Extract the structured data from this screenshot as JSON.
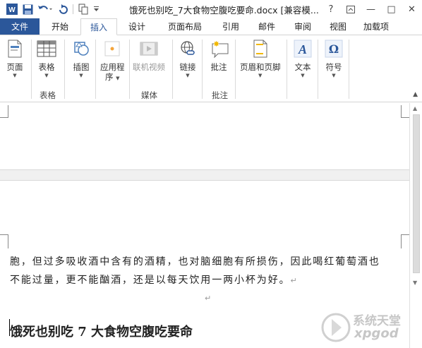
{
  "titlebar": {
    "title": "饿死也别吃_7大食物空腹吃要命.docx [兼容模...",
    "help": "?",
    "controls": [
      "—",
      "□",
      "✕"
    ]
  },
  "tabs": [
    "文件",
    "开始",
    "插入",
    "设计",
    "页面布局",
    "引用",
    "邮件",
    "审阅",
    "视图",
    "加载项"
  ],
  "ribbon": {
    "buttons": {
      "page": "页面",
      "table": "表格",
      "illustrations": "插图",
      "apps": "应用程",
      "apps2": "序",
      "online_video": "联机视频",
      "link": "链接",
      "comment": "批注",
      "header_footer": "页眉和页脚",
      "text": "文本",
      "symbols": "符号"
    },
    "groups": {
      "tables": "表格",
      "media": "媒体",
      "comments": "批注"
    }
  },
  "document": {
    "line1": "胞，但过多吸收酒中含有的酒精，也对脑细胞有所损伤，因此喝红葡萄酒也",
    "line2": "不能过量，更不能酗酒，还是以每天饮用一两小杯为好。",
    "para_mark": "↵",
    "heading": "饿死也别吃 7 大食物空腹吃要命"
  },
  "watermark": {
    "line1": "系统天堂",
    "line2": "xpgod"
  },
  "colors": {
    "accent": "#2b579a"
  }
}
